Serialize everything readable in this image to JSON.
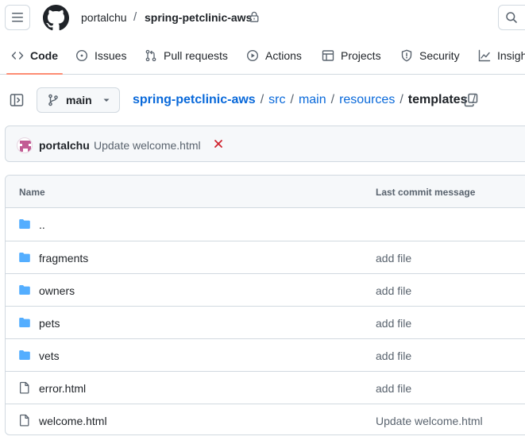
{
  "header": {
    "owner": "portalchu",
    "separator": "/",
    "repo": "spring-petclinic-aws"
  },
  "nav": {
    "items": [
      {
        "label": "Code",
        "icon": "code-icon",
        "active": true
      },
      {
        "label": "Issues",
        "icon": "issue-icon"
      },
      {
        "label": "Pull requests",
        "icon": "pull-request-icon"
      },
      {
        "label": "Actions",
        "icon": "play-icon"
      },
      {
        "label": "Projects",
        "icon": "table-icon"
      },
      {
        "label": "Security",
        "icon": "shield-icon"
      },
      {
        "label": "Insights",
        "icon": "graph-icon"
      }
    ]
  },
  "branch": {
    "name": "main"
  },
  "breadcrumb": {
    "repo": "spring-petclinic-aws",
    "sep": "/",
    "parts": [
      "src",
      "main",
      "resources"
    ],
    "current": "templates",
    "trailing_sep": "/"
  },
  "commit": {
    "author": "portalchu",
    "message": "Update welcome.html",
    "status": "failed",
    "status_color": "#cf222e"
  },
  "table": {
    "headers": {
      "name": "Name",
      "message": "Last commit message"
    },
    "rows": [
      {
        "name": "..",
        "type": "folder",
        "message": ""
      },
      {
        "name": "fragments",
        "type": "folder",
        "message": "add file"
      },
      {
        "name": "owners",
        "type": "folder",
        "message": "add file"
      },
      {
        "name": "pets",
        "type": "folder",
        "message": "add file"
      },
      {
        "name": "vets",
        "type": "folder",
        "message": "add file"
      },
      {
        "name": "error.html",
        "type": "file",
        "message": "add file"
      },
      {
        "name": "welcome.html",
        "type": "file",
        "message": "Update welcome.html"
      }
    ]
  },
  "colors": {
    "link": "#0969da",
    "folder": "#54aeff",
    "active_tab_underline": "#fd8c73",
    "border": "#d1d9e0"
  }
}
